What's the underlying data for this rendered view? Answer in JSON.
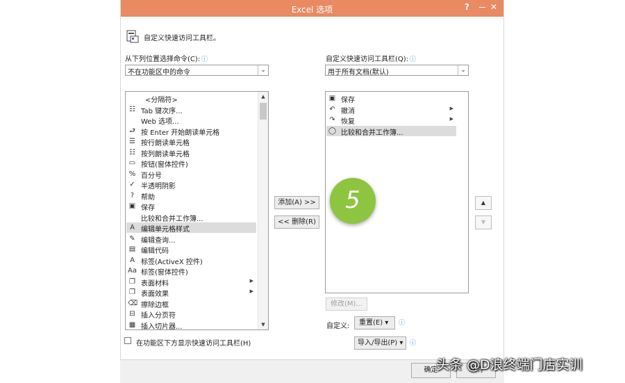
{
  "window": {
    "title": "Excel 选项",
    "help": "?",
    "close": "✕"
  },
  "header": {
    "text": "自定义快速访问工具栏。"
  },
  "left": {
    "label": "从下列位置选择命令(C):",
    "info": "ⓘ",
    "combo_value": "不在功能区中的命令",
    "items": [
      {
        "icon": "",
        "label": "<分隔符>",
        "indent": true
      },
      {
        "icon": "☷",
        "label": "Tab 键次序..."
      },
      {
        "icon": "",
        "label": "Web 选项..."
      },
      {
        "icon": "⮐",
        "label": "按 Enter 开始朗读单元格"
      },
      {
        "icon": "☰",
        "label": "按行朗读单元格"
      },
      {
        "icon": "☷",
        "label": "按列朗读单元格"
      },
      {
        "icon": "▭",
        "label": "按钮(窗体控件)"
      },
      {
        "icon": "%",
        "label": "百分号"
      },
      {
        "icon": "✓",
        "label": "半透明阴影"
      },
      {
        "icon": "?",
        "label": "帮助"
      },
      {
        "icon": "▣",
        "label": "保存"
      },
      {
        "icon": "",
        "label": "比较和合并工作簿..."
      },
      {
        "icon": "A",
        "label": "编辑单元格样式",
        "selected": true
      },
      {
        "icon": "✎",
        "label": "编辑查询..."
      },
      {
        "icon": "▤",
        "label": "编辑代码"
      },
      {
        "icon": "A",
        "label": "标签(ActiveX 控件)"
      },
      {
        "icon": "Aa",
        "label": "标签(窗体控件)"
      },
      {
        "icon": "❐",
        "label": "表面材料",
        "submenu": true
      },
      {
        "icon": "❐",
        "label": "表面效果",
        "submenu": true
      },
      {
        "icon": "⌫",
        "label": "擦除边框"
      },
      {
        "icon": "⊟",
        "label": "插入分页符"
      },
      {
        "icon": "▦",
        "label": "插入切片器..."
      }
    ]
  },
  "right": {
    "label": "自定义快速访问工具栏(Q):",
    "info": "ⓘ",
    "combo_value": "用于所有文档(默认)",
    "items": [
      {
        "icon": "▣",
        "label": "保存"
      },
      {
        "icon": "↶",
        "label": "撤消",
        "submenu": true
      },
      {
        "icon": "↷",
        "label": "恢复",
        "submenu": true
      },
      {
        "icon": "◯",
        "label": "比较和合并工作簿...",
        "selected": true
      }
    ],
    "modify_button": "修改(M)...",
    "customize_label": "自定义:",
    "reset_button": "重置(E)",
    "import_export_button": "导入/导出(P)"
  },
  "middle": {
    "add_button": "添加(A) >>",
    "remove_button": "<< 删除(R)"
  },
  "step_badge": "5",
  "updown": {
    "up": "▲",
    "down": "▼"
  },
  "checkbox_label": "在功能区下方显示快速访问工具栏(H)",
  "footer": {
    "ok_button": "确定",
    "cancel_button": "取消"
  },
  "watermark": "头条 @D浪终端门店实训"
}
